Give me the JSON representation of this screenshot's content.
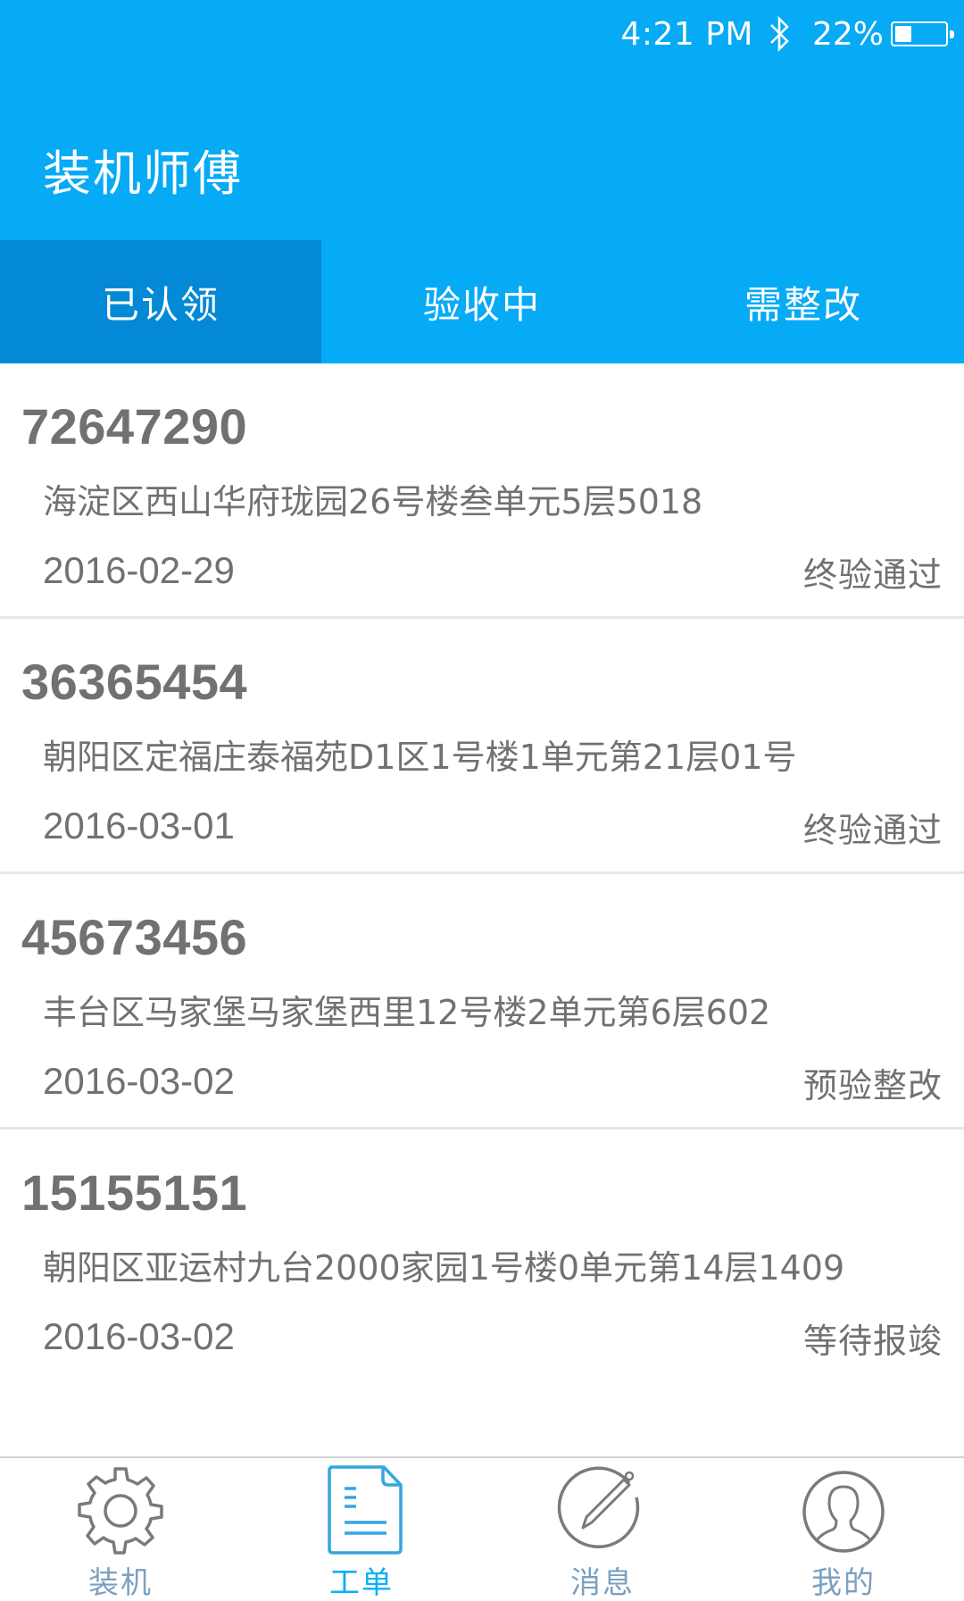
{
  "status_bar": {
    "time": "4:21 PM",
    "bluetooth_icon": "bluetooth-icon",
    "battery_percent_label": "22%",
    "battery_level": 0.22,
    "battery_icon": "battery-icon"
  },
  "header": {
    "title": "装机师傅",
    "background_color": "#06aaf5"
  },
  "tabs": [
    {
      "label": "已认领",
      "active": true
    },
    {
      "label": "验收中",
      "active": false
    },
    {
      "label": "需整改",
      "active": false
    }
  ],
  "active_tab_color": "#0389d5",
  "orders": [
    {
      "order_no": "72647290",
      "address": "海淀区西山华府珑园26号楼叁单元5层5018",
      "date": "2016-02-29",
      "status": "终验通过"
    },
    {
      "order_no": "36365454",
      "address": "朝阳区定福庄泰福苑D1区1号楼1单元第21层01号",
      "date": "2016-03-01",
      "status": "终验通过"
    },
    {
      "order_no": "45673456",
      "address": "丰台区马家堡马家堡西里12号楼2单元第6层602",
      "date": "2016-03-02",
      "status": "预验整改"
    },
    {
      "order_no": "15155151",
      "address": "朝阳区亚运村九台2000家园1号楼0单元第14层1409",
      "date": "2016-03-02",
      "status": "等待报竣"
    }
  ],
  "bottom_nav": [
    {
      "label": "装机",
      "icon": "gear-icon",
      "active": false
    },
    {
      "label": "工单",
      "icon": "document-icon",
      "active": true
    },
    {
      "label": "消息",
      "icon": "pencil-circle-icon",
      "active": false
    },
    {
      "label": "我的",
      "icon": "user-circle-icon",
      "active": false
    }
  ],
  "colors": {
    "text_gray": "#717171",
    "nav_inactive": "#7ba0c0",
    "nav_active": "#0ab0f4",
    "icon_gray": "#7a7a7a",
    "icon_active": "#35a6e0"
  }
}
